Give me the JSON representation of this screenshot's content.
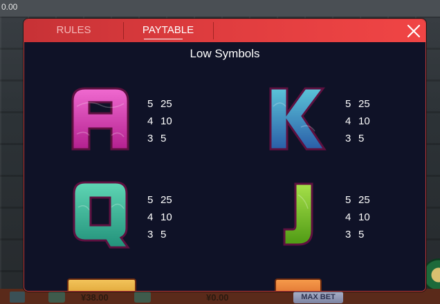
{
  "background": {
    "balance": "0.00",
    "bet": "¥38.00",
    "win": "¥0.00",
    "max_bet_label": "MAX BET"
  },
  "modal": {
    "tabs": [
      {
        "label": "RULES",
        "active": false
      },
      {
        "label": "PAYTABLE",
        "active": true
      }
    ],
    "close_icon": "close-icon",
    "section_title": "Low Symbols",
    "symbols": [
      {
        "name": "A",
        "color": "#d63bb3",
        "pays": [
          {
            "count": "5",
            "value": "25"
          },
          {
            "count": "4",
            "value": "10"
          },
          {
            "count": "3",
            "value": "5"
          }
        ]
      },
      {
        "name": "K",
        "color": "#3a8fb8",
        "pays": [
          {
            "count": "5",
            "value": "25"
          },
          {
            "count": "4",
            "value": "10"
          },
          {
            "count": "3",
            "value": "5"
          }
        ]
      },
      {
        "name": "Q",
        "color": "#2fb59a",
        "pays": [
          {
            "count": "5",
            "value": "25"
          },
          {
            "count": "4",
            "value": "10"
          },
          {
            "count": "3",
            "value": "5"
          }
        ]
      },
      {
        "name": "J",
        "color": "#78b81f",
        "pays": [
          {
            "count": "5",
            "value": "25"
          },
          {
            "count": "4",
            "value": "10"
          },
          {
            "count": "3",
            "value": "5"
          }
        ]
      }
    ]
  },
  "colors": {
    "header_red": "#e03d3f",
    "modal_bg": "#0f1227"
  }
}
